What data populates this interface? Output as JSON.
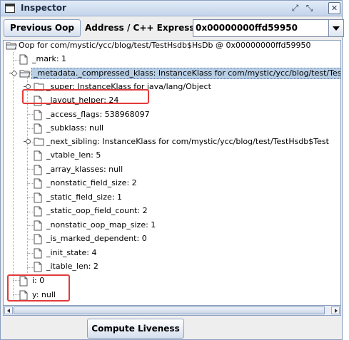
{
  "window": {
    "title": "Inspector",
    "title_buttons": [
      "restore-icon",
      "maximize-icon",
      "close-icon"
    ]
  },
  "toolbar": {
    "previous_oop_label": "Previous Oop",
    "address_label": "Address / C++ Expression:",
    "address_value": "0x00000000ffd59950"
  },
  "tree": {
    "root": "Oop for com/mystic/ycc/blog/test/TestHsdb$HsDb @ 0x00000000ffd59950",
    "mark": "_mark: 1",
    "metadata": "_metadata._compressed_klass: InstanceKlass for com/mystic/ycc/blog/test/Tes",
    "metadata_children": [
      "_super: InstanceKlass for java/lang/Object",
      "_layout_helper: 24",
      "_access_flags: 538968097",
      "_subklass: null",
      "_next_sibling: InstanceKlass for com/mystic/ycc/blog/test/TestHsdb$Test",
      "_vtable_len: 5",
      "_array_klasses: null",
      "_nonstatic_field_size: 2",
      "_static_field_size: 1",
      "_static_oop_field_count: 2",
      "_nonstatic_oop_map_size: 1",
      "_is_marked_dependent: 0",
      "_init_state: 4",
      "_itable_len: 2"
    ],
    "i_field": "i: 0",
    "y_field": "y: null"
  },
  "bottom": {
    "compute_liveness_label": "Compute Liveness"
  },
  "colors": {
    "selection": "#b8cfe5",
    "highlight": "#e23a3a",
    "titlebar": "#c3d3ea"
  }
}
